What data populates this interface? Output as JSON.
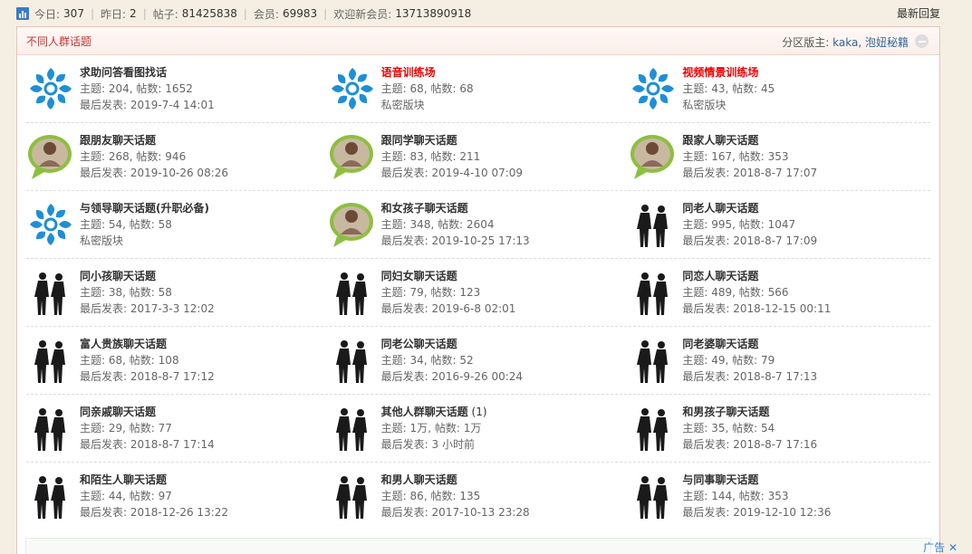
{
  "stats": {
    "today_label": "今日:",
    "today": "307",
    "yesterday_label": "昨日:",
    "yesterday": "2",
    "posts_label": "帖子:",
    "posts": "81425838",
    "members_label": "会员:",
    "members": "69983",
    "newest_label": "欢迎新会员:",
    "newest": "13713890918"
  },
  "latest_reply": "最新回复",
  "panel": {
    "title": "不同人群话题",
    "mods_label": "分区版主:",
    "mod1": "kaka",
    "sep": ", ",
    "mod2": "泡妞秘籍"
  },
  "colors": {
    "accent_red": "#e00",
    "title_red": "#c33",
    "link_blue": "#336699"
  },
  "forums": [
    {
      "name": "求助问答看图找话",
      "topics": "204",
      "posts": "1652",
      "last_label": "最后发表:",
      "last": "2019-7-4 14:01",
      "icon": "default-forum-icon",
      "red": false
    },
    {
      "name": "语音训练场",
      "topics": "68",
      "posts": "68",
      "private": "私密版块",
      "icon": "default-forum-icon",
      "red": true
    },
    {
      "name": "视频情景训练场",
      "topics": "43",
      "posts": "45",
      "private": "私密版块",
      "icon": "default-forum-icon",
      "red": true
    },
    {
      "name": "跟朋友聊天话题",
      "topics": "268",
      "posts": "946",
      "last": "2019-10-26 08:26",
      "icon": "photo-bubble-icon"
    },
    {
      "name": "跟同学聊天话题",
      "topics": "83",
      "posts": "211",
      "last": "2019-4-10 07:09",
      "icon": "photo-bubble-icon"
    },
    {
      "name": "跟家人聊天话题",
      "topics": "167",
      "posts": "353",
      "last": "2018-8-7 17:07",
      "icon": "photo-bubble-icon"
    },
    {
      "name": "与领导聊天话题(升职必备)",
      "topics": "54",
      "posts": "58",
      "private": "私密版块",
      "icon": "default-forum-icon"
    },
    {
      "name": "和女孩子聊天话题",
      "topics": "348",
      "posts": "2604",
      "last": "2019-10-25 17:13",
      "icon": "photo-bubble-icon"
    },
    {
      "name": "同老人聊天话题",
      "topics": "995",
      "posts": "1047",
      "last": "2018-8-7 17:09",
      "icon": "silhouette-icon"
    },
    {
      "name": "同小孩聊天话题",
      "topics": "38",
      "posts": "58",
      "last": "2017-3-3 12:02",
      "icon": "silhouette-icon"
    },
    {
      "name": "同妇女聊天话题",
      "topics": "79",
      "posts": "123",
      "last": "2019-6-8 02:01",
      "icon": "silhouette-icon"
    },
    {
      "name": "同恋人聊天话题",
      "topics": "489",
      "posts": "566",
      "last": "2018-12-15 00:11",
      "icon": "silhouette-icon"
    },
    {
      "name": "富人贵族聊天话题",
      "topics": "68",
      "posts": "108",
      "last": "2018-8-7 17:12",
      "icon": "silhouette-icon"
    },
    {
      "name": "同老公聊天话题",
      "topics": "34",
      "posts": "52",
      "last": "2016-9-26 00:24",
      "icon": "silhouette-icon"
    },
    {
      "name": "同老婆聊天话题",
      "topics": "49",
      "posts": "79",
      "last": "2018-8-7 17:13",
      "icon": "silhouette-icon"
    },
    {
      "name": "同亲戚聊天话题",
      "topics": "29",
      "posts": "77",
      "last": "2018-8-7 17:14",
      "icon": "silhouette-icon"
    },
    {
      "name": "其他人群聊天话题",
      "count": "(1)",
      "topics": "1万",
      "posts": "1万",
      "last": "3 小时前",
      "icon": "silhouette-icon"
    },
    {
      "name": "和男孩子聊天话题",
      "topics": "35",
      "posts": "54",
      "last": "2018-8-7 17:16",
      "icon": "silhouette-icon"
    },
    {
      "name": "和陌生人聊天话题",
      "topics": "44",
      "posts": "97",
      "last": "2018-12-26 13:22",
      "icon": "silhouette-icon"
    },
    {
      "name": "和男人聊天话题",
      "topics": "86",
      "posts": "135",
      "last": "2017-10-13 23:28",
      "icon": "silhouette-icon"
    },
    {
      "name": "与同事聊天话题",
      "topics": "144",
      "posts": "353",
      "last": "2019-12-10 12:36",
      "icon": "silhouette-icon"
    }
  ],
  "labels": {
    "topics": "主题:",
    "posts": "帖数:",
    "last": "最后发表:"
  },
  "ad_label": "广告"
}
